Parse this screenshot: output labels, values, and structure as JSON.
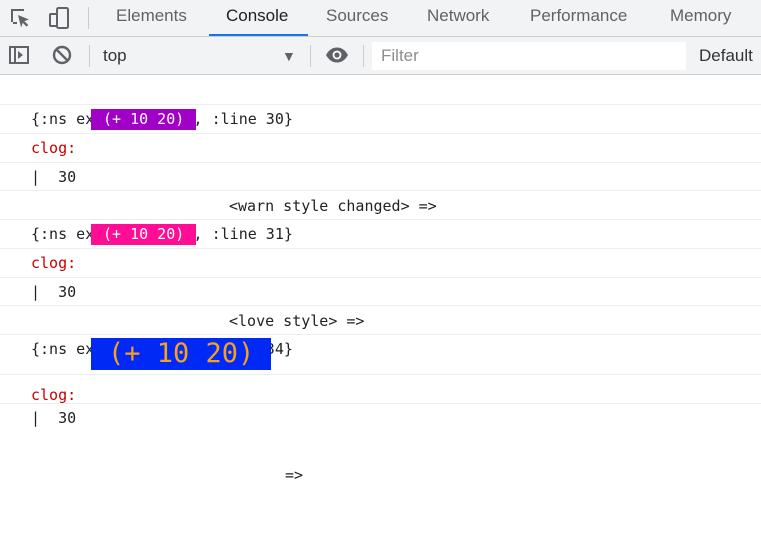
{
  "tabs": [
    {
      "label": "Elements"
    },
    {
      "label": "Console"
    },
    {
      "label": "Sources"
    },
    {
      "label": "Network"
    },
    {
      "label": "Performance"
    },
    {
      "label": "Memory"
    }
  ],
  "active_tab": "Console",
  "toolbar": {
    "context": "top",
    "filter_placeholder": "Filter",
    "levels": "Default"
  },
  "icons": {
    "inspect": "inspect-element-icon",
    "device": "device-toolbar-icon",
    "sidebar": "show-sidebar-icon",
    "clear": "clear-console-icon",
    "context_dropdown": "dropdown-arrow-icon",
    "live_expression": "eye-icon"
  },
  "entries": [
    {
      "meta": "{:ns examples.demo, :line 30}",
      "clog_label": "clog:",
      "expr": "(+ 10 20)",
      "badge_bg": "#a100c6",
      "badge_fg": "#ffffff",
      "style_note": "<warn style changed> =>",
      "result": "|  30"
    },
    {
      "meta": "{:ns examples.demo, :line 31}",
      "clog_label": "clog:",
      "expr": "(+ 10 20)",
      "badge_bg": "#ff0d94",
      "badge_fg": "#ffffff",
      "style_note": "<love style> =>",
      "result": "|  30"
    },
    {
      "meta": "{:ns examples.demo, :line 34}",
      "clog_label": "clog:",
      "expr": "(+ 10 20)",
      "badge_bg": "#0029f5",
      "badge_fg": "#f7a01c",
      "style_note": "=>",
      "result": "|  30"
    }
  ]
}
